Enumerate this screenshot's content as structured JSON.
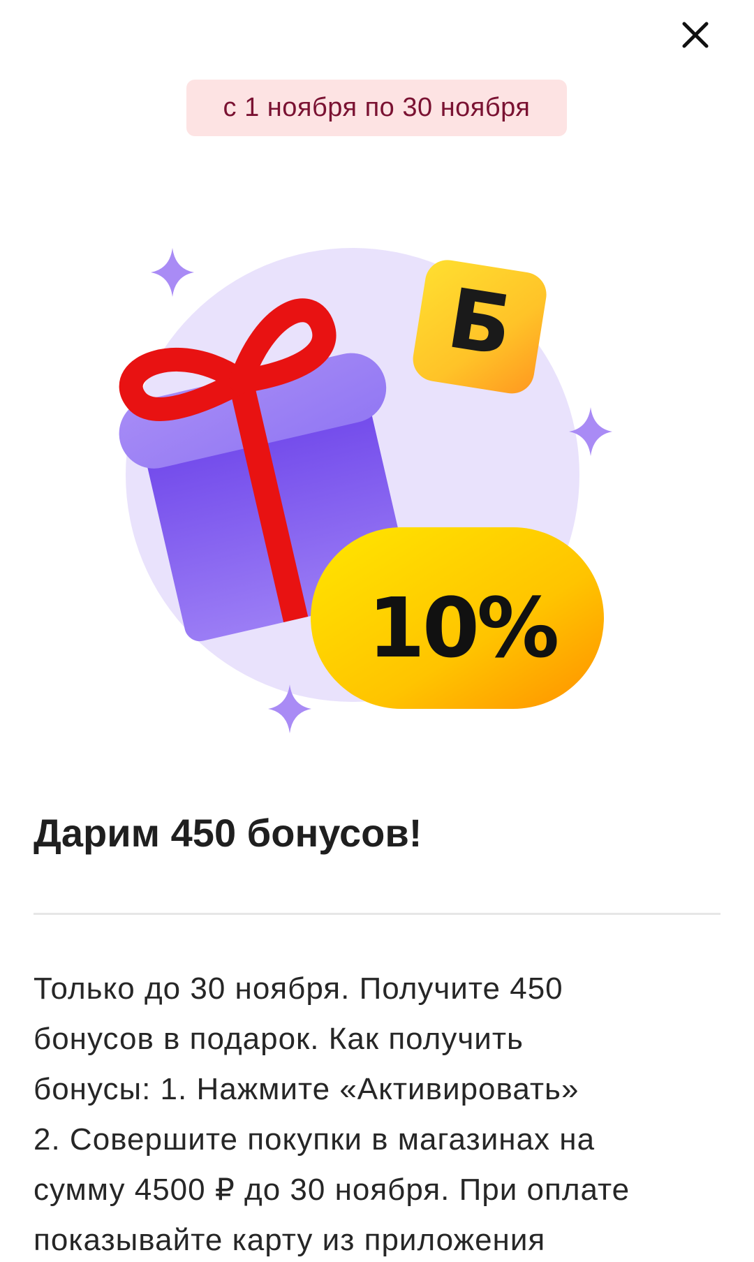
{
  "header": {
    "close_icon": "close-icon"
  },
  "promo": {
    "date_range": "с 1 ноября по 30 ноября",
    "illustration": {
      "coin_letter": "Б",
      "badge_text": "10%",
      "colors": {
        "gift_box": "#7b52f0",
        "ribbon": "#e81212",
        "badge_yellow": "#ffd400",
        "badge_orange": "#ff9a00",
        "sparkle": "#a98bf5",
        "circle_bg": "#e9e2fc"
      }
    },
    "title": "Дарим 450 бонусов!",
    "description_lines": [
      "Только до 30 ноября. Получите 450",
      "бонусов в подарок. Как получить",
      "бонусы: 1. Нажмите «Активировать»",
      "2. Совершите покупки в магазинах на",
      "сумму 4500 ₽ до 30 ноября. При оплате",
      "показывайте карту из приложения"
    ]
  },
  "theme": {
    "badge_bg": "#fde3e3",
    "badge_text": "#7a1232",
    "text": "#1f1f1f"
  }
}
